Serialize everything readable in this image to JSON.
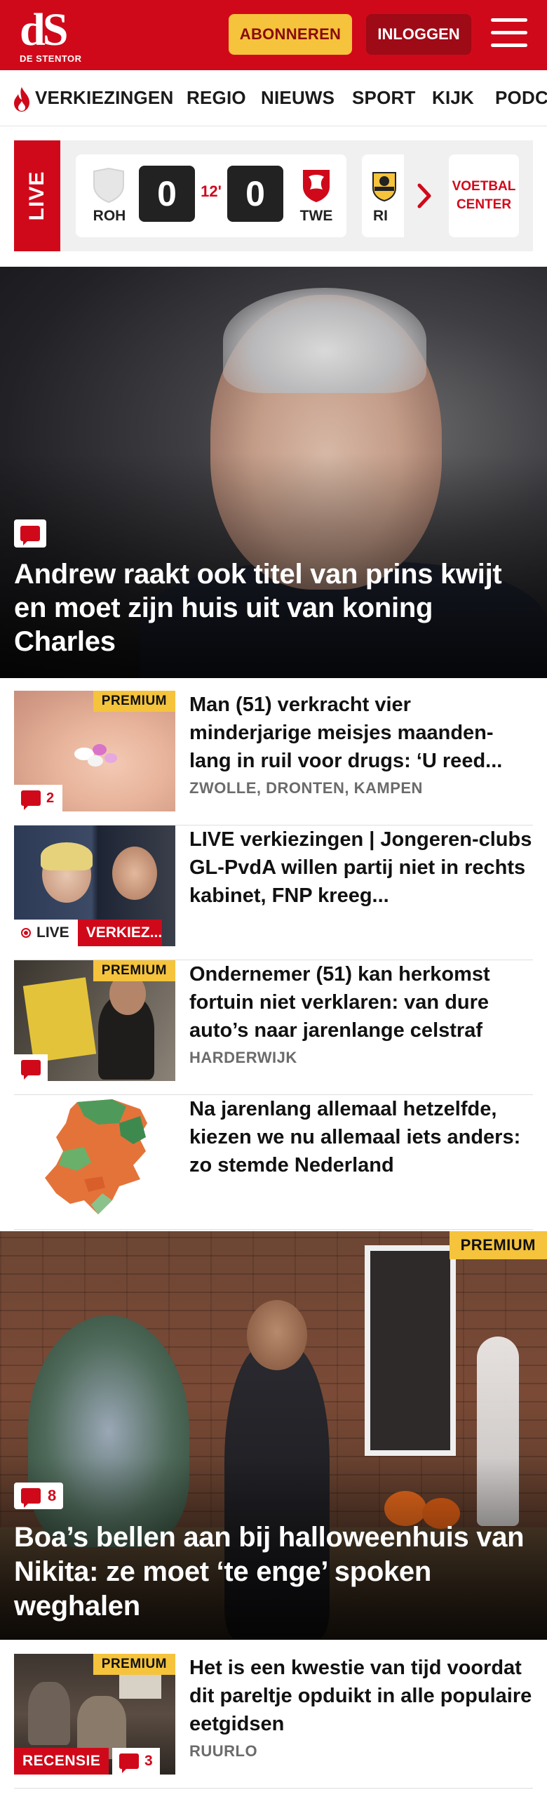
{
  "header": {
    "logo_mark": "dS",
    "logo_sub": "DE STENTOR",
    "subscribe_label": "ABONNEREN",
    "login_label": "INLOGGEN"
  },
  "nav": {
    "items": [
      "VERKIEZINGEN",
      "REGIO",
      "NIEUWS",
      "SPORT",
      "KIJK",
      "PODC"
    ]
  },
  "live": {
    "tag": "LIVE",
    "match": {
      "home": "ROH",
      "home_score": "0",
      "minute": "12'",
      "away_score": "0",
      "away": "TWE"
    },
    "next_team": "RI",
    "voetbal_center": "VOETBAL CENTER"
  },
  "hero": {
    "title": "Andrew raakt ook titel van prins kwijt en moet zijn huis uit van koning Charles"
  },
  "articles": [
    {
      "title": "Man (51) verkracht vier minderjarige meisjes maanden-lang in ruil voor drugs: ‘U reed...",
      "tag": "ZWOLLE, DRONTEN, KAMPEN",
      "premium": "PREMIUM",
      "comments": "2"
    },
    {
      "title": "LIVE verkiezingen | Jongeren-clubs GL-PvdA willen partij niet in rechts kabinet, FNP kreeg...",
      "live_label": "LIVE",
      "section_label": "VERKIEZ..."
    },
    {
      "title": "Ondernemer (51) kan herkomst fortuin niet verklaren: van dure auto’s naar jarenlange celstraf",
      "tag": "HARDERWIJK",
      "premium": "PREMIUM"
    },
    {
      "title": "Na jarenlang allemaal hetzelfde, kiezen we nu allemaal iets anders: zo stemde Nederland"
    }
  ],
  "hero2": {
    "premium": "PREMIUM",
    "comments": "8",
    "title": "Boa’s bellen aan bij halloweenhuis van Nikita: ze moet ‘te enge’ spoken weghalen"
  },
  "article5": {
    "title": "Het is een kwestie van tijd voordat dit pareltje opduikt in alle populaire eetgidsen",
    "tag": "RUURLO",
    "premium": "PREMIUM",
    "review_label": "RECENSIE",
    "comments": "3"
  },
  "colors": {
    "brand_red": "#d0091a",
    "premium_yellow": "#f5c33c",
    "login_dark_red": "#9e0a16"
  }
}
